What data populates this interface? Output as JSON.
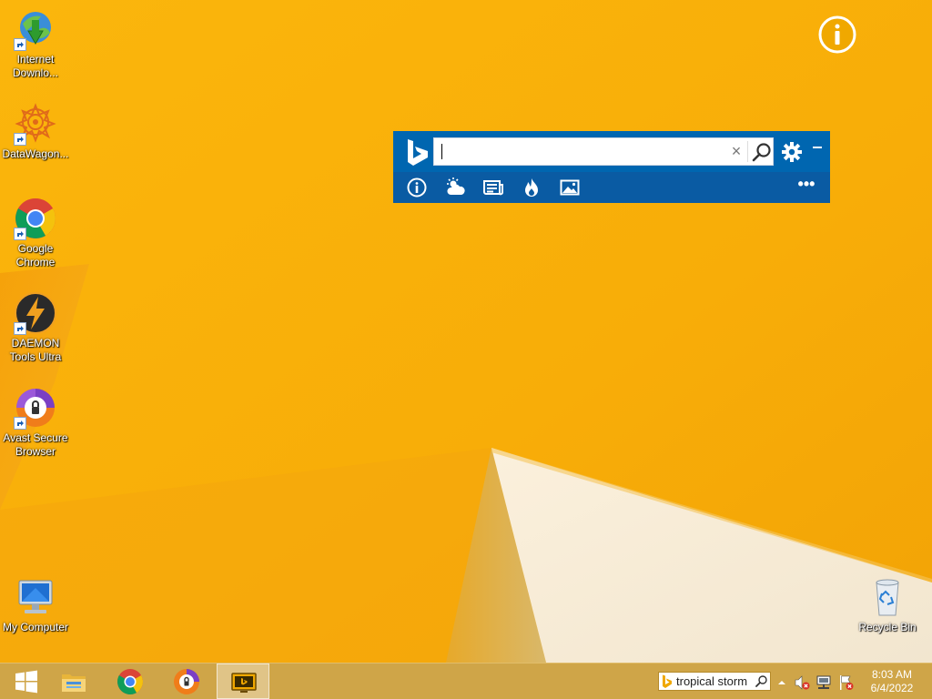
{
  "desktop": {
    "icons": [
      {
        "label": "Internet\nDownlo...",
        "icon": "internet-download-manager-icon"
      },
      {
        "label": "DataWagon...",
        "icon": "datawagon-icon"
      },
      {
        "label": "Google\nChrome",
        "icon": "chrome-icon"
      },
      {
        "label": "DAEMON\nTools Ultra",
        "icon": "daemon-tools-icon"
      },
      {
        "label": "Avast Secure\nBrowser",
        "icon": "avast-browser-icon"
      },
      {
        "label": "My Computer",
        "icon": "computer-icon"
      },
      {
        "label": "Recycle Bin",
        "icon": "recycle-bin-icon"
      }
    ],
    "info_icon": "info-icon"
  },
  "bing_bar": {
    "search_value": "",
    "clear_glyph": "×",
    "more_glyph": "•••",
    "tools": [
      "info-icon",
      "weather-icon",
      "news-icon",
      "trending-icon",
      "images-icon"
    ],
    "colors": {
      "primary": "#0066b0",
      "toolbar": "#0a5ba3"
    }
  },
  "taskbar": {
    "pinned": [
      "start-button",
      "file-explorer",
      "google-chrome",
      "avast-secure-browser",
      "bing-desktop"
    ],
    "search_text": "tropical storm",
    "tray_icons": [
      "show-hidden-icons",
      "volume-muted-icon",
      "network-icon",
      "action-center-icon"
    ],
    "time": "8:03 AM",
    "date": "6/4/2022"
  }
}
